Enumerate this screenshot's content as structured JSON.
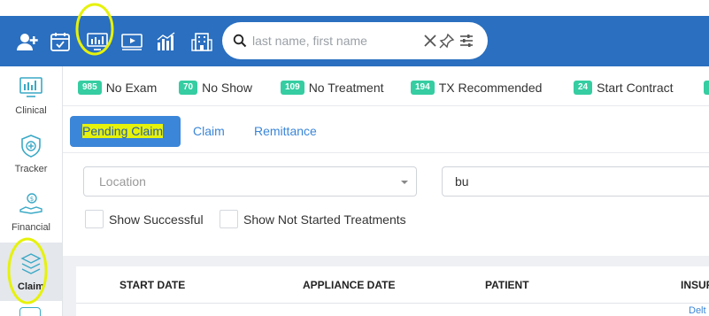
{
  "topbar": {
    "icons": [
      "add-user-icon",
      "calendar-check-icon",
      "monitor-chart-icon",
      "video-icon",
      "bar-chart-icon",
      "building-icon"
    ],
    "search": {
      "placeholder": "last name, first name",
      "value": ""
    }
  },
  "sidebar": {
    "items": [
      {
        "label": "Clinical",
        "icon": "monitor-chart-icon",
        "active": false
      },
      {
        "label": "Tracker",
        "icon": "tracker-icon",
        "active": false
      },
      {
        "label": "Financial",
        "icon": "money-hand-icon",
        "active": false
      },
      {
        "label": "Claim",
        "icon": "claim-icon",
        "active": true
      }
    ]
  },
  "counts": [
    {
      "value": "985",
      "label": "No Exam"
    },
    {
      "value": "70",
      "label": "No Show"
    },
    {
      "value": "109",
      "label": "No Treatment"
    },
    {
      "value": "194",
      "label": "TX Recommended"
    },
    {
      "value": "24",
      "label": "Start Contract"
    }
  ],
  "tabs": [
    {
      "label": "Pending Claim",
      "active": true
    },
    {
      "label": "Claim",
      "active": false
    },
    {
      "label": "Remittance",
      "active": false
    }
  ],
  "filters": {
    "location": {
      "placeholder": "Location"
    },
    "text_value": "bu",
    "checks": [
      {
        "label": "Show Successful"
      },
      {
        "label": "Show Not Started Treatments"
      }
    ]
  },
  "table": {
    "headers": [
      "START DATE",
      "APPLIANCE DATE",
      "PATIENT",
      "INSUR"
    ],
    "first_row_partial": "Delt"
  },
  "colors": {
    "brand_blue": "#2a6fc0",
    "tab_blue": "#3b86d8",
    "badge_green": "#35cda1",
    "highlight": "#e6f20a"
  }
}
